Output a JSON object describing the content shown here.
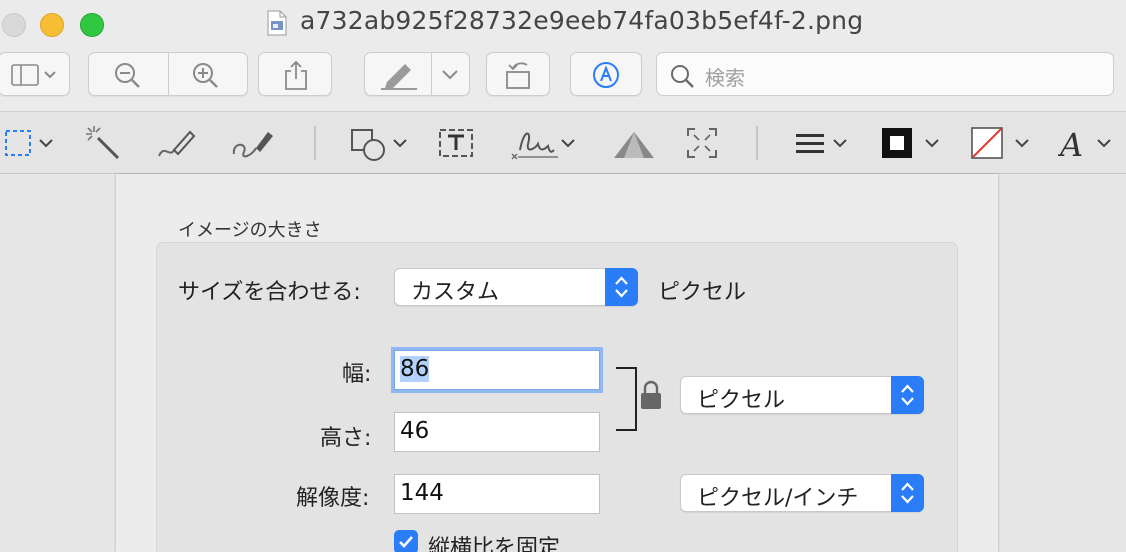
{
  "window": {
    "title": "a732ab925f28732e9eeb74fa03b5ef4f-2.png"
  },
  "toolbar": {
    "search_placeholder": "検索"
  },
  "dialog": {
    "group_title": "イメージの大きさ",
    "fit_label": "サイズを合わせる:",
    "fit_value": "カスタム",
    "fit_unit": "ピクセル",
    "width_label": "幅:",
    "width_value": "86",
    "height_label": "高さ:",
    "height_value": "46",
    "unit_value": "ピクセル",
    "resolution_label": "解像度:",
    "resolution_value": "144",
    "resolution_unit": "ピクセル/インチ",
    "constrain_label": "縦横比を固定",
    "constrain_checked": true
  },
  "colors": {
    "accent": "#2a7df6",
    "selection": "#b3d1fb"
  }
}
